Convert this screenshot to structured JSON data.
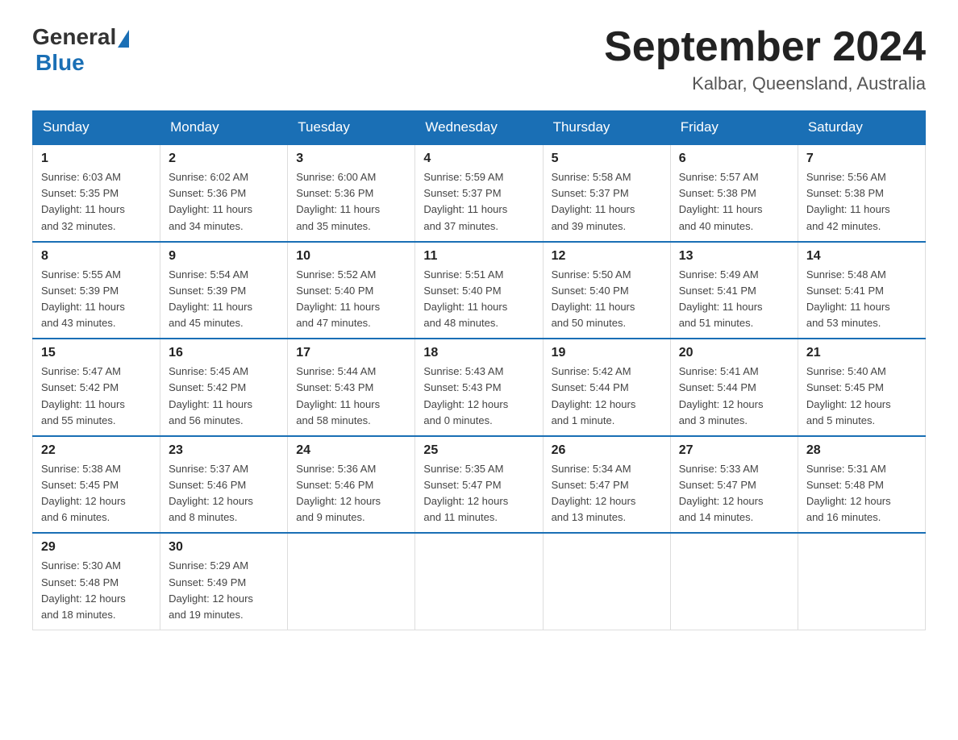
{
  "logo": {
    "general": "General",
    "blue": "Blue"
  },
  "title": "September 2024",
  "subtitle": "Kalbar, Queensland, Australia",
  "days_of_week": [
    "Sunday",
    "Monday",
    "Tuesday",
    "Wednesday",
    "Thursday",
    "Friday",
    "Saturday"
  ],
  "weeks": [
    [
      {
        "day": 1,
        "sunrise": "6:03 AM",
        "sunset": "5:35 PM",
        "daylight": "11 hours and 32 minutes."
      },
      {
        "day": 2,
        "sunrise": "6:02 AM",
        "sunset": "5:36 PM",
        "daylight": "11 hours and 34 minutes."
      },
      {
        "day": 3,
        "sunrise": "6:00 AM",
        "sunset": "5:36 PM",
        "daylight": "11 hours and 35 minutes."
      },
      {
        "day": 4,
        "sunrise": "5:59 AM",
        "sunset": "5:37 PM",
        "daylight": "11 hours and 37 minutes."
      },
      {
        "day": 5,
        "sunrise": "5:58 AM",
        "sunset": "5:37 PM",
        "daylight": "11 hours and 39 minutes."
      },
      {
        "day": 6,
        "sunrise": "5:57 AM",
        "sunset": "5:38 PM",
        "daylight": "11 hours and 40 minutes."
      },
      {
        "day": 7,
        "sunrise": "5:56 AM",
        "sunset": "5:38 PM",
        "daylight": "11 hours and 42 minutes."
      }
    ],
    [
      {
        "day": 8,
        "sunrise": "5:55 AM",
        "sunset": "5:39 PM",
        "daylight": "11 hours and 43 minutes."
      },
      {
        "day": 9,
        "sunrise": "5:54 AM",
        "sunset": "5:39 PM",
        "daylight": "11 hours and 45 minutes."
      },
      {
        "day": 10,
        "sunrise": "5:52 AM",
        "sunset": "5:40 PM",
        "daylight": "11 hours and 47 minutes."
      },
      {
        "day": 11,
        "sunrise": "5:51 AM",
        "sunset": "5:40 PM",
        "daylight": "11 hours and 48 minutes."
      },
      {
        "day": 12,
        "sunrise": "5:50 AM",
        "sunset": "5:40 PM",
        "daylight": "11 hours and 50 minutes."
      },
      {
        "day": 13,
        "sunrise": "5:49 AM",
        "sunset": "5:41 PM",
        "daylight": "11 hours and 51 minutes."
      },
      {
        "day": 14,
        "sunrise": "5:48 AM",
        "sunset": "5:41 PM",
        "daylight": "11 hours and 53 minutes."
      }
    ],
    [
      {
        "day": 15,
        "sunrise": "5:47 AM",
        "sunset": "5:42 PM",
        "daylight": "11 hours and 55 minutes."
      },
      {
        "day": 16,
        "sunrise": "5:45 AM",
        "sunset": "5:42 PM",
        "daylight": "11 hours and 56 minutes."
      },
      {
        "day": 17,
        "sunrise": "5:44 AM",
        "sunset": "5:43 PM",
        "daylight": "11 hours and 58 minutes."
      },
      {
        "day": 18,
        "sunrise": "5:43 AM",
        "sunset": "5:43 PM",
        "daylight": "12 hours and 0 minutes."
      },
      {
        "day": 19,
        "sunrise": "5:42 AM",
        "sunset": "5:44 PM",
        "daylight": "12 hours and 1 minute."
      },
      {
        "day": 20,
        "sunrise": "5:41 AM",
        "sunset": "5:44 PM",
        "daylight": "12 hours and 3 minutes."
      },
      {
        "day": 21,
        "sunrise": "5:40 AM",
        "sunset": "5:45 PM",
        "daylight": "12 hours and 5 minutes."
      }
    ],
    [
      {
        "day": 22,
        "sunrise": "5:38 AM",
        "sunset": "5:45 PM",
        "daylight": "12 hours and 6 minutes."
      },
      {
        "day": 23,
        "sunrise": "5:37 AM",
        "sunset": "5:46 PM",
        "daylight": "12 hours and 8 minutes."
      },
      {
        "day": 24,
        "sunrise": "5:36 AM",
        "sunset": "5:46 PM",
        "daylight": "12 hours and 9 minutes."
      },
      {
        "day": 25,
        "sunrise": "5:35 AM",
        "sunset": "5:47 PM",
        "daylight": "12 hours and 11 minutes."
      },
      {
        "day": 26,
        "sunrise": "5:34 AM",
        "sunset": "5:47 PM",
        "daylight": "12 hours and 13 minutes."
      },
      {
        "day": 27,
        "sunrise": "5:33 AM",
        "sunset": "5:47 PM",
        "daylight": "12 hours and 14 minutes."
      },
      {
        "day": 28,
        "sunrise": "5:31 AM",
        "sunset": "5:48 PM",
        "daylight": "12 hours and 16 minutes."
      }
    ],
    [
      {
        "day": 29,
        "sunrise": "5:30 AM",
        "sunset": "5:48 PM",
        "daylight": "12 hours and 18 minutes."
      },
      {
        "day": 30,
        "sunrise": "5:29 AM",
        "sunset": "5:49 PM",
        "daylight": "12 hours and 19 minutes."
      },
      null,
      null,
      null,
      null,
      null
    ]
  ],
  "labels": {
    "sunrise": "Sunrise:",
    "sunset": "Sunset:",
    "daylight": "Daylight:"
  }
}
